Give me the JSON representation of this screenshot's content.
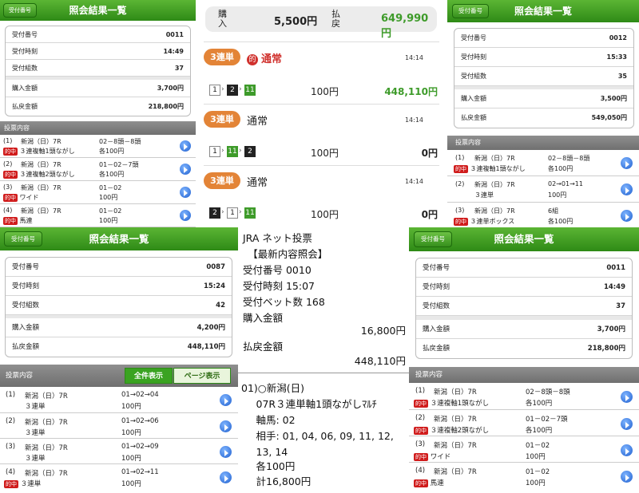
{
  "p1": {
    "back": "受付番号",
    "title": "照会結果一覧",
    "rows": [
      {
        "label": "受付番号",
        "value": "0011"
      },
      {
        "label": "受付時刻",
        "value": "14:49"
      },
      {
        "label": "受付組数",
        "value": "37"
      },
      {
        "label": "購入金額",
        "value": "3,700円"
      },
      {
        "label": "払戻金額",
        "value": "218,800円"
      }
    ],
    "section": "投票内容",
    "items": [
      {
        "num": "(1)",
        "race": "新潟（日）7R",
        "hit": "的中",
        "bet": "３連複軸1頭ながし",
        "combo": "02－8頭－8頭",
        "each": "各100円"
      },
      {
        "num": "(2)",
        "race": "新潟（日）7R",
        "hit": "的中",
        "bet": "３連複軸2頭ながし",
        "combo": "01－02－7頭",
        "each": "各100円"
      },
      {
        "num": "(3)",
        "race": "新潟（日）7R",
        "hit": "的中",
        "bet": "ワイド",
        "combo": "01－02",
        "each": "100円"
      },
      {
        "num": "(4)",
        "race": "新潟（日）7R",
        "hit": "的中",
        "bet": "馬連",
        "combo": "01－02",
        "each": "100円"
      }
    ]
  },
  "p2": {
    "buy_label": "購入",
    "buy_value": "5,500円",
    "pay_label": "払戻",
    "pay_value": "649,990円",
    "bets": [
      {
        "type_pill": "3連単",
        "mark": "的",
        "kind": "通常",
        "time": "14:14",
        "nums": [
          "1",
          "2",
          "11"
        ],
        "amount": "100円",
        "payout": "448,110円"
      },
      {
        "type_pill": "3連単",
        "mark": "",
        "kind": "通常",
        "time": "14:14",
        "nums": [
          "1",
          "11",
          "2"
        ],
        "amount": "100円",
        "payout": "0円"
      },
      {
        "type_pill": "3連単",
        "mark": "",
        "kind": "通常",
        "time": "14:14",
        "nums": [
          "2",
          "1",
          "11"
        ],
        "amount": "100円",
        "payout": "0円"
      }
    ]
  },
  "p3": {
    "back": "受付番号",
    "title": "照会結果一覧",
    "rows": [
      {
        "label": "受付番号",
        "value": "0012"
      },
      {
        "label": "受付時刻",
        "value": "15:33"
      },
      {
        "label": "受付組数",
        "value": "35"
      },
      {
        "label": "購入金額",
        "value": "3,500円"
      },
      {
        "label": "払戻金額",
        "value": "549,050円"
      }
    ],
    "section": "投票内容",
    "items": [
      {
        "num": "(1)",
        "race": "新潟（日）7R",
        "hit": "的中",
        "bet": "３連複軸1頭ながし",
        "combo": "02－8頭－8頭",
        "each": "各100円"
      },
      {
        "num": "(2)",
        "race": "新潟（日）7R",
        "hit": "",
        "bet": "３連単",
        "combo": "02→01→11",
        "each": "100円"
      },
      {
        "num": "(3)",
        "race": "新潟（日）7R",
        "hit": "的中",
        "bet": "３連単ボックス",
        "combo": "6組",
        "each": "各100円"
      }
    ]
  },
  "p4": {
    "back": "受付番号",
    "title": "照会結果一覧",
    "rows": [
      {
        "label": "受付番号",
        "value": "0087"
      },
      {
        "label": "受付時刻",
        "value": "15:24"
      },
      {
        "label": "受付組数",
        "value": "42"
      },
      {
        "label": "購入金額",
        "value": "4,200円"
      },
      {
        "label": "払戻金額",
        "value": "448,110円"
      }
    ],
    "section": "投票内容",
    "tab_all": "全件表示",
    "tab_page": "ページ表示",
    "items": [
      {
        "num": "(1)",
        "race": "新潟（日）7R",
        "hit": "",
        "bet": "３連単",
        "combo": "01→02→04",
        "each": "100円"
      },
      {
        "num": "(2)",
        "race": "新潟（日）7R",
        "hit": "",
        "bet": "３連単",
        "combo": "01→02→06",
        "each": "100円"
      },
      {
        "num": "(3)",
        "race": "新潟（日）7R",
        "hit": "",
        "bet": "３連単",
        "combo": "01→02→09",
        "each": "100円"
      },
      {
        "num": "(4)",
        "race": "新潟（日）7R",
        "hit": "的中",
        "bet": "３連単",
        "combo": "01→02→11",
        "each": "100円"
      }
    ]
  },
  "p5": {
    "lines": [
      "JRA ネット投票",
      "　【最新内容照会】",
      "受付番号 0010",
      "受付時刻 15:07",
      "受付ベット数 168",
      "購入金額"
    ],
    "buy_amount": "16,800円",
    "pay_label": "払戻金額",
    "pay_amount": "448,110円",
    "detail": [
      "01)○新潟(日)",
      "　07R３連単軸1頭ながしﾏﾙﾁ",
      "　軸馬: 02",
      "　相手: 01, 04, 06, 09, 11, 12,",
      "　13, 14",
      "　各100円",
      "　計16,800円"
    ]
  },
  "p6": {
    "back": "受付番号",
    "title": "照会結果一覧",
    "rows": [
      {
        "label": "受付番号",
        "value": "0011"
      },
      {
        "label": "受付時刻",
        "value": "14:49"
      },
      {
        "label": "受付組数",
        "value": "37"
      },
      {
        "label": "購入金額",
        "value": "3,700円"
      },
      {
        "label": "払戻金額",
        "value": "218,800円"
      }
    ],
    "section": "投票内容",
    "items": [
      {
        "num": "(1)",
        "race": "新潟（日）7R",
        "hit": "的中",
        "bet": "３連複軸1頭ながし",
        "combo": "02－8頭－8頭",
        "each": "各100円"
      },
      {
        "num": "(2)",
        "race": "新潟（日）7R",
        "hit": "的中",
        "bet": "３連複軸2頭ながし",
        "combo": "01－02－7頭",
        "each": "各100円"
      },
      {
        "num": "(3)",
        "race": "新潟（日）7R",
        "hit": "的中",
        "bet": "ワイド",
        "combo": "01－02",
        "each": "100円"
      },
      {
        "num": "(4)",
        "race": "新潟（日）7R",
        "hit": "的中",
        "bet": "馬連",
        "combo": "01－02",
        "each": "100円"
      }
    ]
  },
  "colors": {
    "header_green": "#2e8a16",
    "hit_red": "#d01c1c",
    "payout_green": "#3e9b2a",
    "pill_orange": "#e38437",
    "arrow_blue": "#1f5fcf"
  }
}
